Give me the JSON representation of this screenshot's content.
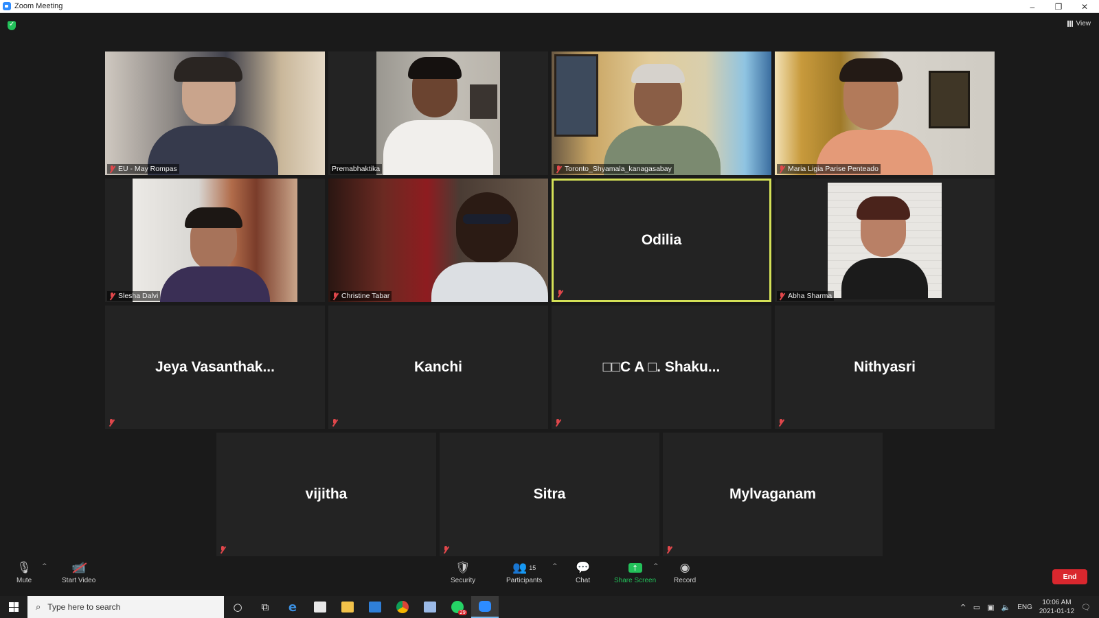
{
  "window": {
    "title": "Zoom Meeting",
    "controls": [
      "–",
      "❐",
      "✕"
    ]
  },
  "header": {
    "view_label": "View",
    "security_icon": "shield-check-icon"
  },
  "participants": [
    {
      "name": "EU - May Rompas",
      "video": true,
      "muted": true
    },
    {
      "name": "Premabhaktika",
      "video": true,
      "muted": false
    },
    {
      "name": "Toronto_Shyamala_kanagasabay",
      "video": true,
      "muted": true
    },
    {
      "name": "Maria Ligia Parise Penteado",
      "video": true,
      "muted": true
    },
    {
      "name": "Slesha Dalvi",
      "video": true,
      "muted": true
    },
    {
      "name": "Christine Tabar",
      "video": true,
      "muted": true
    },
    {
      "name": "Odilia",
      "video": false,
      "muted": true,
      "active_speaker": true
    },
    {
      "name": "Abha Sharma",
      "video": true,
      "muted": true
    },
    {
      "name": "Jeya Vasanthak...",
      "video": false,
      "muted": true
    },
    {
      "name": "Kanchi",
      "video": false,
      "muted": true
    },
    {
      "name": "□□C A □. Shaku...",
      "video": false,
      "muted": true
    },
    {
      "name": "Nithyasri",
      "video": false,
      "muted": true
    },
    {
      "name": "vijitha",
      "video": false,
      "muted": true
    },
    {
      "name": "Sitra",
      "video": false,
      "muted": true
    },
    {
      "name": "Mylvaganam",
      "video": false,
      "muted": true
    }
  ],
  "toolbar": {
    "mute_label": "Mute",
    "start_video_label": "Start Video",
    "security_label": "Security",
    "participants_label": "Participants",
    "participants_count": "15",
    "chat_label": "Chat",
    "share_screen_label": "Share Screen",
    "record_label": "Record",
    "end_label": "End"
  },
  "taskbar": {
    "search_placeholder": "Type here to search",
    "whatsapp_badge": "29",
    "language": "ENG",
    "time": "10:06 AM",
    "date": "2021-01-12"
  },
  "colors": {
    "accent_green": "#23c15a",
    "speaker_border": "#d4e157",
    "end_red": "#d9272e",
    "zoom_blue": "#2d8cff"
  }
}
